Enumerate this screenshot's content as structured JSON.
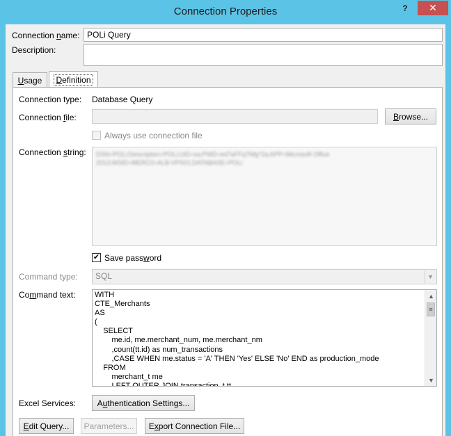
{
  "window": {
    "title": "Connection Properties",
    "help_glyph": "?",
    "close_glyph": "✕"
  },
  "connection_name": {
    "label_pre": "Connection ",
    "label_u": "n",
    "label_post": "ame:",
    "value": "POLi Query"
  },
  "description": {
    "label": "Description:",
    "value": ""
  },
  "tabs": [
    {
      "label_u": "U",
      "label_post": "sage"
    },
    {
      "label_u": "D",
      "label_post": "efinition"
    }
  ],
  "definition": {
    "connection_type_label": "Connection type:",
    "connection_type_value": "Database Query",
    "connection_file_label_pre": "Connection ",
    "connection_file_label_u": "f",
    "connection_file_label_post": "ile:",
    "browse_label_u": "B",
    "browse_label_post": "rowse...",
    "always_use_label": "Always use connection file",
    "connection_string_label_pre": "Connection ",
    "connection_string_label_u": "s",
    "connection_string_label_post": "tring:",
    "connection_string_line1": "DSN=POLi;Description=POLi;UID=sa;PWD=ed7aFFq7Nfg*2a;APP=Microsoft Office",
    "connection_string_line2": "2013;WSID=MERCO-ALB-VPS01;DATABASE=POLi",
    "save_password_label_pre": "Save pass",
    "save_password_label_u": "w",
    "save_password_label_post": "ord",
    "save_password_check": "✔",
    "command_type_label": "Command type:",
    "command_type_value": "SQL",
    "command_type_arrow": "▼",
    "command_text_label_pre": "Co",
    "command_text_label_u": "m",
    "command_text_label_post": "mand text:",
    "command_text": "WITH\nCTE_Merchants\nAS\n(\n    SELECT\n        me.id, me.merchant_num, me.merchant_nm\n        ,count(tt.id) as num_transactions\n        ,CASE WHEN me.status = 'A' THEN 'Yes' ELSE 'No' END as production_mode\n    FROM\n        merchant_t me\n        LEFT OUTER JOIN transaction_t tt",
    "scroll_up": "▲",
    "scroll_down": "▼",
    "scroll_grip": "≡",
    "excel_services_label": "Excel Services:",
    "auth_settings_label_pre": "A",
    "auth_settings_label_u": "u",
    "auth_settings_label_post": "thentication Settings..."
  },
  "footer": {
    "edit_query_label_u": "E",
    "edit_query_label_post": "dit Query...",
    "parameters_label": "Parameters...",
    "export_label_pre": "E",
    "export_label_u": "x",
    "export_label_post": "port Connection File..."
  }
}
